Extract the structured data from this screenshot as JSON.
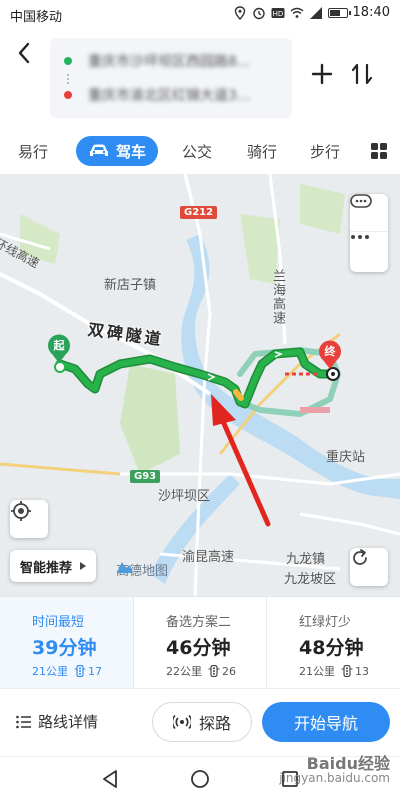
{
  "status_bar": {
    "carrier": "中国移动",
    "time": "18:40"
  },
  "header": {
    "start_text": "重庆市沙坪坝区西园路8...",
    "end_text": "重庆市渝北区红锦大道3..."
  },
  "tabs": [
    {
      "label": "易行"
    },
    {
      "label": "驾车"
    },
    {
      "label": "公交"
    },
    {
      "label": "骑行"
    },
    {
      "label": "步行"
    }
  ],
  "map": {
    "labels": {
      "xindianzi": "新店子镇",
      "lanhai": "兰海高速",
      "shapingba": "沙坪坝区",
      "yukun": "渝昆高速",
      "jiulongzhen": "九龙镇",
      "jiulongpo": "九龙坡区",
      "chongqing_station": "重庆站",
      "ring": "环线高速"
    },
    "badges": {
      "g212": "G212",
      "g93": "G93"
    },
    "tunnel": "双碑隧道",
    "start_pin": "起",
    "end_pin": "终",
    "smart_recommend": "智能推荐",
    "logo": "高德地图"
  },
  "options": [
    {
      "title": "时间最短",
      "time": "39分钟",
      "distance": "21公里",
      "lights": "17"
    },
    {
      "title": "备选方案二",
      "time": "46分钟",
      "distance": "22公里",
      "lights": "26"
    },
    {
      "title": "红绿灯少",
      "time": "48分钟",
      "distance": "21公里",
      "lights": "13"
    }
  ],
  "actions": {
    "detail": "路线详情",
    "explore": "探路",
    "start": "开始导航"
  },
  "watermark": {
    "line1": "Baidu经验",
    "line2": "jingyan.baidu.com"
  },
  "colors": {
    "accent": "#2f8cf2",
    "route": "#27b24a",
    "alt_route": "#8fd0b8"
  }
}
